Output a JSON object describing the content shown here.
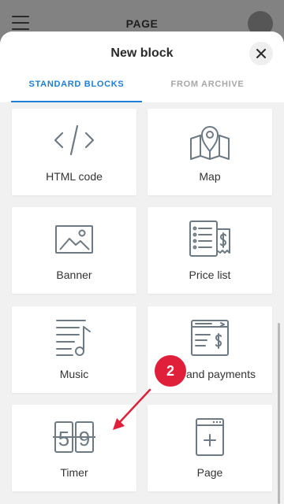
{
  "app": {
    "title": "PAGE"
  },
  "sheet": {
    "title": "New block",
    "tabs": [
      {
        "label": "STANDARD BLOCKS",
        "active": true
      },
      {
        "label": "FROM ARCHIVE",
        "active": false
      }
    ],
    "blocks": [
      {
        "label": "HTML code",
        "icon": "code-icon"
      },
      {
        "label": "Map",
        "icon": "map-pin-icon"
      },
      {
        "label": "Banner",
        "icon": "image-icon"
      },
      {
        "label": "Price list",
        "icon": "price-list-icon"
      },
      {
        "label": "Music",
        "icon": "music-icon"
      },
      {
        "label": "and payments",
        "icon": "payment-icon"
      },
      {
        "label": "Timer",
        "icon": "timer-icon"
      },
      {
        "label": "Page",
        "icon": "page-icon"
      }
    ]
  },
  "annotation": {
    "step": "2"
  },
  "colors": {
    "accent": "#1e7fd6",
    "annotation": "#e0203a",
    "icon": "#6e7a83"
  }
}
